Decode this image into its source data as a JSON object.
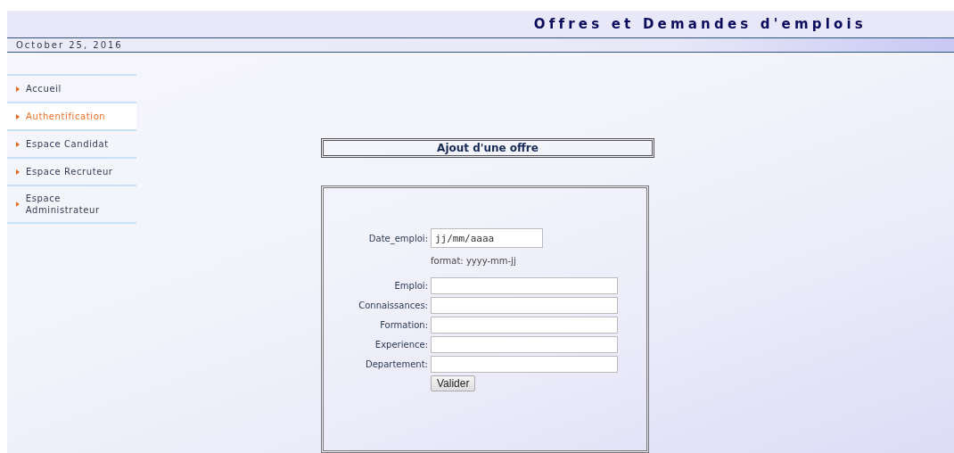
{
  "header": {
    "title": "Offres et Demandes d'emplois",
    "date": "October 25, 2016"
  },
  "sidebar": {
    "items": [
      {
        "label": "Accueil",
        "selected": false
      },
      {
        "label": "Authentification",
        "selected": true
      },
      {
        "label": "Espace Candidat",
        "selected": false
      },
      {
        "label": "Espace Recruteur",
        "selected": false
      },
      {
        "label": "Espace Administrateur",
        "selected": false
      }
    ]
  },
  "form": {
    "title": "Ajout d'une offre",
    "fields": [
      {
        "kind": "date",
        "label": "Date_emploi:",
        "placeholder": "jj/mm/aaaa",
        "hint": "format: yyyy-mm-jj"
      },
      {
        "kind": "text",
        "label": "Emploi:"
      },
      {
        "kind": "text",
        "label": "Connaissances:"
      },
      {
        "kind": "text",
        "label": "Formation:"
      },
      {
        "kind": "text",
        "label": "Experience:"
      },
      {
        "kind": "text",
        "label": "Departement:"
      }
    ],
    "submit": "Valider"
  }
}
